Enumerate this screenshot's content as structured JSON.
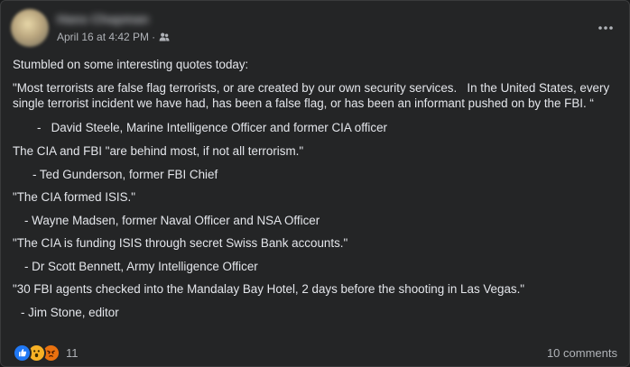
{
  "post": {
    "author": "Hans Chapman",
    "timestamp": "April 16 at 4:42 PM",
    "separator": "·",
    "audience_icon": "friends-icon",
    "paragraphs": [
      "Stumbled on some interesting quotes today:",
      "\"Most terrorists are false flag terrorists, or are created by our own security services.   In the United States, every single terrorist incident we have had, has been a false flag, or has been an informant pushed on by the FBI. “",
      "-   David Steele, Marine Intelligence Officer and former CIA officer",
      "The CIA and FBI \"are behind most, if not all terrorism.\"",
      "- Ted Gunderson, former FBI Chief",
      "\"The CIA formed ISIS.\"",
      "- Wayne Madsen, former Naval Officer and NSA Officer",
      "\"The CIA is funding ISIS through secret Swiss Bank accounts.\"",
      "- Dr Scott Bennett, Army Intelligence Officer",
      "\"30 FBI agents checked into the Mandalay Bay Hotel, 2 days before the shooting in Las Vegas.\"",
      "- Jim Stone, editor"
    ]
  },
  "footer": {
    "reaction_icons": [
      "like-icon",
      "wow-icon",
      "angry-icon"
    ],
    "reaction_count": "11",
    "comments": "10 comments"
  },
  "colors": {
    "card_background": "#242526",
    "text": "#e4e6eb",
    "secondary_text": "#b0b3b8",
    "like_blue": "#2078f4",
    "wow_yellow": "#f7b125",
    "angry_orange": "#e9710f"
  }
}
